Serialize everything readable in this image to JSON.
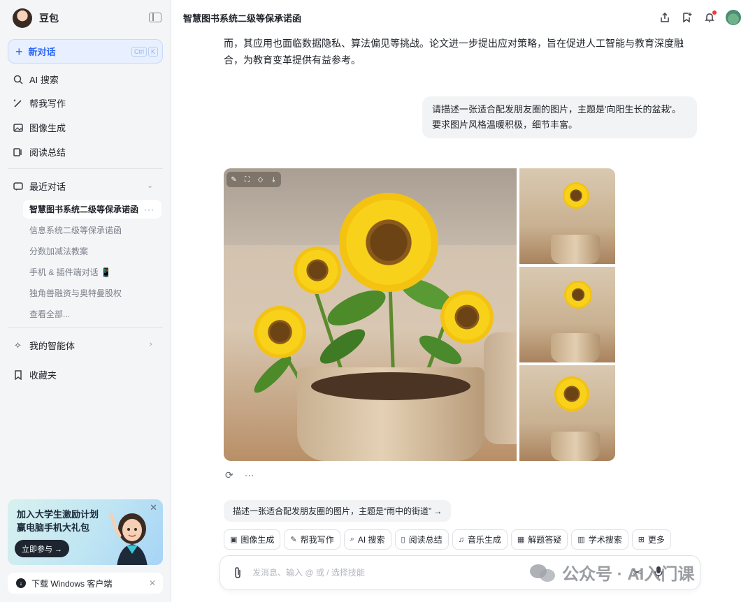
{
  "sidebar": {
    "brand": "豆包",
    "new_chat": "新对话",
    "new_chat_shortcut": [
      "Ctrl",
      "K"
    ],
    "nav": [
      {
        "label": "AI 搜索",
        "icon": "ai-search-icon"
      },
      {
        "label": "帮我写作",
        "icon": "pen-icon"
      },
      {
        "label": "图像生成",
        "icon": "image-icon"
      },
      {
        "label": "阅读总结",
        "icon": "read-icon"
      }
    ],
    "recent": {
      "title": "最近对话",
      "active": "智慧图书系统二级等保承诺函",
      "items": [
        "信息系统二级等保承诺函",
        "分数加减法教案",
        "手机 & 插件端对话 📱",
        "独角兽融资与奥特曼股权",
        "查看全部..."
      ]
    },
    "agents": "我的智能体",
    "favorites": "收藏夹",
    "promo": {
      "line1": "加入大学生激励计划",
      "line2": "赢电脑手机大礼包",
      "cta": "立即参与 →"
    },
    "download": "下载 Windows 客户端"
  },
  "header": {
    "title": "智慧图书系统二级等保承诺函"
  },
  "conversation": {
    "answer_tail": "而，其应用也面临数据隐私、算法偏见等挑战。论文进一步提出应对策略，旨在促进人工智能与教育深度融合，为教育变革提供有益参考。",
    "user_prompt": "请描述一张适合配发朋友圈的图片，主题是'向阳生长的盆栽'。要求图片风格温暖积极，细节丰富。",
    "suggestion": "描述一张适合配发朋友圈的图片，主题是“雨中的街道” →"
  },
  "skills": [
    {
      "label": "图像生成",
      "icon": "image-icon"
    },
    {
      "label": "帮我写作",
      "icon": "pen-icon"
    },
    {
      "label": "AI 搜索",
      "icon": "ai-search-icon"
    },
    {
      "label": "阅读总结",
      "icon": "read-icon"
    },
    {
      "label": "音乐生成",
      "icon": "music-icon"
    },
    {
      "label": "解题答疑",
      "icon": "solve-icon"
    },
    {
      "label": "学术搜索",
      "icon": "academic-icon"
    },
    {
      "label": "更多",
      "icon": "more-grid-icon"
    }
  ],
  "composer": {
    "placeholder": "发消息、输入 @ 或 / 选择技能"
  },
  "watermark": "公众号 · AI入门课",
  "colors": {
    "accent": "#2c66f5",
    "sidebar_bg": "#f4f5f7",
    "bubble_bg": "#f2f3f5"
  }
}
